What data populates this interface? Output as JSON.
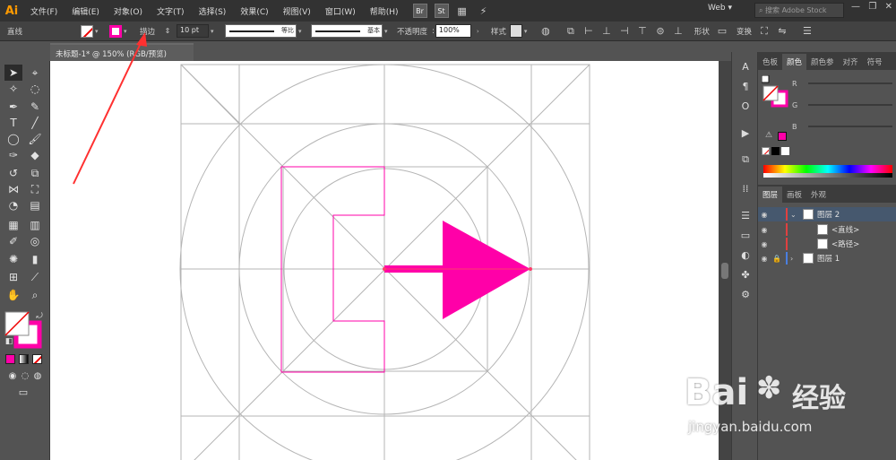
{
  "app": {
    "logo": "Ai",
    "menu": [
      "文件(F)",
      "编辑(E)",
      "对象(O)",
      "文字(T)",
      "选择(S)",
      "效果(C)",
      "视图(V)",
      "窗口(W)",
      "帮助(H)"
    ],
    "bridge": "Br",
    "stock": "St",
    "workspace": "Web",
    "search_placeholder": "搜索 Adobe Stock"
  },
  "controlbar": {
    "object_type": "直线",
    "stroke_label": "描边",
    "stroke_weight": "10 pt",
    "profile_label": "等比",
    "brush_label": "基本",
    "opacity_label": "不透明度",
    "opacity_value": "100%",
    "style_label": "样式",
    "shape_label": "形状",
    "transform_label": "变换"
  },
  "document": {
    "tab_title": "未标题-1* @ 150% (RGB/预览)"
  },
  "panels": {
    "color_tabs": [
      "色板",
      "颜色",
      "颜色参",
      "对齐",
      "符号"
    ],
    "sliders": [
      "R",
      "G",
      "B"
    ],
    "layer_tabs": [
      "图层",
      "画板",
      "外观"
    ],
    "layers": [
      {
        "name": "图层 2",
        "color": "#e04040",
        "selected": true,
        "indent": 0
      },
      {
        "name": "<直线>",
        "color": "#e04040",
        "selected": false,
        "indent": 1
      },
      {
        "name": "<路径>",
        "color": "#e04040",
        "selected": false,
        "indent": 1
      },
      {
        "name": "图层 1",
        "color": "#4a7fe0",
        "selected": false,
        "indent": 0
      }
    ]
  },
  "colors": {
    "accent": "#ff00a8",
    "grid": "#b5b5b5",
    "annotation": "#ff3030"
  },
  "watermark": {
    "brand": "Bai",
    "brand_cn": "经验",
    "url": "jingyan.baidu.com"
  }
}
